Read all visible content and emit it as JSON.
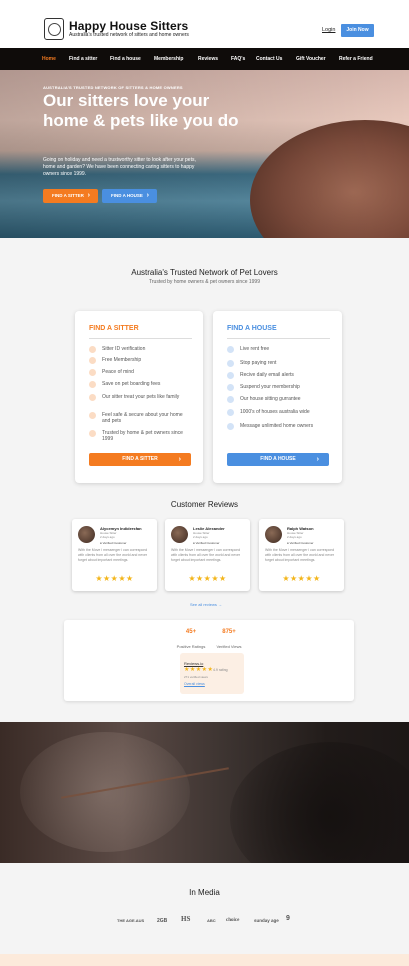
{
  "header": {
    "brand_title": "Happy House Sitters",
    "brand_subtitle": "Australia's trusted network of sitters and home owners",
    "login_label": "Login",
    "join_label": "Join Now"
  },
  "nav": {
    "items": [
      "Home",
      "Find a sitter",
      "Find a house",
      "Membership",
      "Reviews",
      "FAQ's",
      "Contact Us",
      "Gift Voucher",
      "Refer a Friend"
    ]
  },
  "hero": {
    "eyebrow": "AUSTRALIA'S TRUSTED NETWORK OF SITTERS & HOME OWNERS",
    "title": "Our sitters love your home & pets like you do",
    "description": "Going on holiday and need a trustworthy sitter to look after your pets, home and garden? We have been connecting caring sitters to happy owners since 1999.",
    "btn_sitter": "FIND A SITTER",
    "btn_house": "FIND A HOUSE"
  },
  "network": {
    "title": "Australia's Trusted Network of Pet Lovers",
    "subtitle": "Trusted by home owners & pet owners since 1999"
  },
  "sitter_card": {
    "heading": "FIND A SITTER",
    "features": [
      "Sitter ID verification",
      "Free Membership",
      "Peace of mind",
      "Save on pet boarding fees",
      "Our sitter treat your pets like family",
      "Feel safe & secure about your home and pets",
      "Trusted by home & pet owners since 1999"
    ],
    "button": "FIND A SITTER",
    "accent": "#f47b20"
  },
  "house_card": {
    "heading": "FIND A HOUSE",
    "features": [
      "Live rent free",
      "Stop paying rent",
      "Recive daily email alerts",
      "Suspend your membership",
      "Our house sitting gurrantee",
      "1000's of houses australia wide",
      "Message unlimited home owners"
    ],
    "button": "FIND A HOUSE",
    "accent": "#4a8fe0"
  },
  "reviews": {
    "title": "Customer Reviews",
    "items": [
      {
        "name": "Alycemyn Indidersfan",
        "meta1": "House Sitter",
        "meta2": "2 days ago",
        "verified": "Verified Customer",
        "text": "With the Move i messenger i can correspond with clients from all over the world and never forget about important meetings.",
        "stars": "★★★★★"
      },
      {
        "name": "Leslie Alexander",
        "meta1": "House Sitter",
        "meta2": "2 days ago",
        "verified": "Verified Customer",
        "text": "With the Move i messenger i can correspond with clients from all over the world and never forget about important meetings.",
        "stars": "★★★★★"
      },
      {
        "name": "Ralph Watson",
        "meta1": "House Sitter",
        "meta2": "2 days ago",
        "verified": "Verified Customer",
        "text": "With the Move i messenger i can correspond with clients from all over the world and never forget about important meetings.",
        "stars": "★★★★★"
      }
    ],
    "see_all": "See all reviews →"
  },
  "stats": {
    "ratings_num": "45+",
    "ratings_label": "Positive Ratings",
    "views_num": "875+",
    "views_label": "Verified Views",
    "rating_box": {
      "title": "Reviews.io",
      "stars": "★★★★★",
      "score": "4.9 rating",
      "count": "271 verified views",
      "link": "Overall views"
    }
  },
  "media": {
    "title": "In Media",
    "logos": [
      "THE AGE.AUS",
      "2GB",
      "HS",
      "ABC",
      "choice",
      "sunday age",
      "9"
    ]
  }
}
